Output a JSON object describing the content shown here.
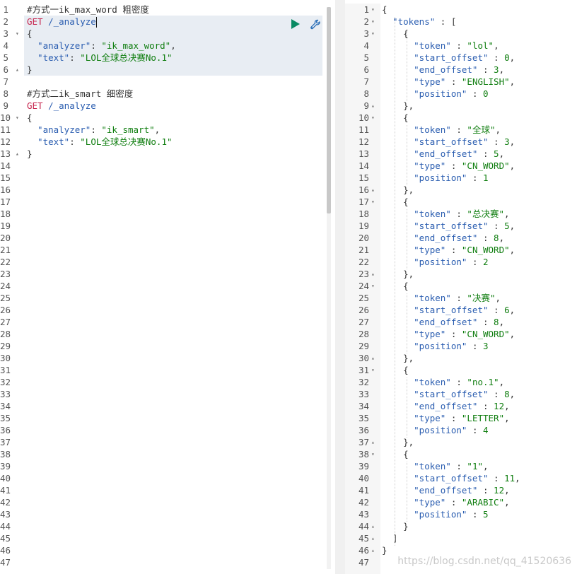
{
  "left_editor": {
    "lines": [
      [
        {
          "t": "#方式一ik_max_word 粗密度",
          "c": "comment"
        }
      ],
      [
        {
          "t": "GET",
          "c": "method"
        },
        {
          "t": " /_analyze",
          "c": "path"
        }
      ],
      [
        {
          "t": "{",
          "c": "punc"
        }
      ],
      [
        {
          "t": "  \"analyzer\"",
          "c": "key"
        },
        {
          "t": ": ",
          "c": "punc"
        },
        {
          "t": "\"ik_max_word\"",
          "c": "str"
        },
        {
          "t": ",",
          "c": "punc"
        }
      ],
      [
        {
          "t": "  \"text\"",
          "c": "key"
        },
        {
          "t": ": ",
          "c": "punc"
        },
        {
          "t": "\"LOL全球总决赛No.1\"",
          "c": "str"
        }
      ],
      [
        {
          "t": "}",
          "c": "punc"
        }
      ],
      [],
      [
        {
          "t": "#方式二ik_smart 细密度",
          "c": "comment"
        }
      ],
      [
        {
          "t": "GET",
          "c": "method"
        },
        {
          "t": " /_analyze",
          "c": "path"
        }
      ],
      [
        {
          "t": "{",
          "c": "punc"
        }
      ],
      [
        {
          "t": "  \"analyzer\"",
          "c": "key"
        },
        {
          "t": ": ",
          "c": "punc"
        },
        {
          "t": "\"ik_smart\"",
          "c": "str"
        },
        {
          "t": ",",
          "c": "punc"
        }
      ],
      [
        {
          "t": "  \"text\"",
          "c": "key"
        },
        {
          "t": ": ",
          "c": "punc"
        },
        {
          "t": "\"LOL全球总决赛No.1\"",
          "c": "str"
        }
      ],
      [
        {
          "t": "}",
          "c": "punc"
        }
      ]
    ],
    "total_line_numbers": 47,
    "folds": {
      "3": "open",
      "6": "close",
      "10": "open",
      "13": "close"
    }
  },
  "right_output": {
    "lines": [
      [
        {
          "t": "{",
          "c": "punc"
        }
      ],
      [
        {
          "t": "  \"tokens\"",
          "c": "key"
        },
        {
          "t": " : [",
          "c": "punc"
        }
      ],
      [
        {
          "t": "    {",
          "c": "punc"
        }
      ],
      [
        {
          "t": "      \"token\"",
          "c": "key"
        },
        {
          "t": " : ",
          "c": "punc"
        },
        {
          "t": "\"lol\"",
          "c": "str"
        },
        {
          "t": ",",
          "c": "punc"
        }
      ],
      [
        {
          "t": "      \"start_offset\"",
          "c": "key"
        },
        {
          "t": " : ",
          "c": "punc"
        },
        {
          "t": "0",
          "c": "num"
        },
        {
          "t": ",",
          "c": "punc"
        }
      ],
      [
        {
          "t": "      \"end_offset\"",
          "c": "key"
        },
        {
          "t": " : ",
          "c": "punc"
        },
        {
          "t": "3",
          "c": "num"
        },
        {
          "t": ",",
          "c": "punc"
        }
      ],
      [
        {
          "t": "      \"type\"",
          "c": "key"
        },
        {
          "t": " : ",
          "c": "punc"
        },
        {
          "t": "\"ENGLISH\"",
          "c": "str"
        },
        {
          "t": ",",
          "c": "punc"
        }
      ],
      [
        {
          "t": "      \"position\"",
          "c": "key"
        },
        {
          "t": " : ",
          "c": "punc"
        },
        {
          "t": "0",
          "c": "num"
        }
      ],
      [
        {
          "t": "    },",
          "c": "punc"
        }
      ],
      [
        {
          "t": "    {",
          "c": "punc"
        }
      ],
      [
        {
          "t": "      \"token\"",
          "c": "key"
        },
        {
          "t": " : ",
          "c": "punc"
        },
        {
          "t": "\"全球\"",
          "c": "str"
        },
        {
          "t": ",",
          "c": "punc"
        }
      ],
      [
        {
          "t": "      \"start_offset\"",
          "c": "key"
        },
        {
          "t": " : ",
          "c": "punc"
        },
        {
          "t": "3",
          "c": "num"
        },
        {
          "t": ",",
          "c": "punc"
        }
      ],
      [
        {
          "t": "      \"end_offset\"",
          "c": "key"
        },
        {
          "t": " : ",
          "c": "punc"
        },
        {
          "t": "5",
          "c": "num"
        },
        {
          "t": ",",
          "c": "punc"
        }
      ],
      [
        {
          "t": "      \"type\"",
          "c": "key"
        },
        {
          "t": " : ",
          "c": "punc"
        },
        {
          "t": "\"CN_WORD\"",
          "c": "str"
        },
        {
          "t": ",",
          "c": "punc"
        }
      ],
      [
        {
          "t": "      \"position\"",
          "c": "key"
        },
        {
          "t": " : ",
          "c": "punc"
        },
        {
          "t": "1",
          "c": "num"
        }
      ],
      [
        {
          "t": "    },",
          "c": "punc"
        }
      ],
      [
        {
          "t": "    {",
          "c": "punc"
        }
      ],
      [
        {
          "t": "      \"token\"",
          "c": "key"
        },
        {
          "t": " : ",
          "c": "punc"
        },
        {
          "t": "\"总决赛\"",
          "c": "str"
        },
        {
          "t": ",",
          "c": "punc"
        }
      ],
      [
        {
          "t": "      \"start_offset\"",
          "c": "key"
        },
        {
          "t": " : ",
          "c": "punc"
        },
        {
          "t": "5",
          "c": "num"
        },
        {
          "t": ",",
          "c": "punc"
        }
      ],
      [
        {
          "t": "      \"end_offset\"",
          "c": "key"
        },
        {
          "t": " : ",
          "c": "punc"
        },
        {
          "t": "8",
          "c": "num"
        },
        {
          "t": ",",
          "c": "punc"
        }
      ],
      [
        {
          "t": "      \"type\"",
          "c": "key"
        },
        {
          "t": " : ",
          "c": "punc"
        },
        {
          "t": "\"CN_WORD\"",
          "c": "str"
        },
        {
          "t": ",",
          "c": "punc"
        }
      ],
      [
        {
          "t": "      \"position\"",
          "c": "key"
        },
        {
          "t": " : ",
          "c": "punc"
        },
        {
          "t": "2",
          "c": "num"
        }
      ],
      [
        {
          "t": "    },",
          "c": "punc"
        }
      ],
      [
        {
          "t": "    {",
          "c": "punc"
        }
      ],
      [
        {
          "t": "      \"token\"",
          "c": "key"
        },
        {
          "t": " : ",
          "c": "punc"
        },
        {
          "t": "\"决赛\"",
          "c": "str"
        },
        {
          "t": ",",
          "c": "punc"
        }
      ],
      [
        {
          "t": "      \"start_offset\"",
          "c": "key"
        },
        {
          "t": " : ",
          "c": "punc"
        },
        {
          "t": "6",
          "c": "num"
        },
        {
          "t": ",",
          "c": "punc"
        }
      ],
      [
        {
          "t": "      \"end_offset\"",
          "c": "key"
        },
        {
          "t": " : ",
          "c": "punc"
        },
        {
          "t": "8",
          "c": "num"
        },
        {
          "t": ",",
          "c": "punc"
        }
      ],
      [
        {
          "t": "      \"type\"",
          "c": "key"
        },
        {
          "t": " : ",
          "c": "punc"
        },
        {
          "t": "\"CN_WORD\"",
          "c": "str"
        },
        {
          "t": ",",
          "c": "punc"
        }
      ],
      [
        {
          "t": "      \"position\"",
          "c": "key"
        },
        {
          "t": " : ",
          "c": "punc"
        },
        {
          "t": "3",
          "c": "num"
        }
      ],
      [
        {
          "t": "    },",
          "c": "punc"
        }
      ],
      [
        {
          "t": "    {",
          "c": "punc"
        }
      ],
      [
        {
          "t": "      \"token\"",
          "c": "key"
        },
        {
          "t": " : ",
          "c": "punc"
        },
        {
          "t": "\"no.1\"",
          "c": "str"
        },
        {
          "t": ",",
          "c": "punc"
        }
      ],
      [
        {
          "t": "      \"start_offset\"",
          "c": "key"
        },
        {
          "t": " : ",
          "c": "punc"
        },
        {
          "t": "8",
          "c": "num"
        },
        {
          "t": ",",
          "c": "punc"
        }
      ],
      [
        {
          "t": "      \"end_offset\"",
          "c": "key"
        },
        {
          "t": " : ",
          "c": "punc"
        },
        {
          "t": "12",
          "c": "num"
        },
        {
          "t": ",",
          "c": "punc"
        }
      ],
      [
        {
          "t": "      \"type\"",
          "c": "key"
        },
        {
          "t": " : ",
          "c": "punc"
        },
        {
          "t": "\"LETTER\"",
          "c": "str"
        },
        {
          "t": ",",
          "c": "punc"
        }
      ],
      [
        {
          "t": "      \"position\"",
          "c": "key"
        },
        {
          "t": " : ",
          "c": "punc"
        },
        {
          "t": "4",
          "c": "num"
        }
      ],
      [
        {
          "t": "    },",
          "c": "punc"
        }
      ],
      [
        {
          "t": "    {",
          "c": "punc"
        }
      ],
      [
        {
          "t": "      \"token\"",
          "c": "key"
        },
        {
          "t": " : ",
          "c": "punc"
        },
        {
          "t": "\"1\"",
          "c": "str"
        },
        {
          "t": ",",
          "c": "punc"
        }
      ],
      [
        {
          "t": "      \"start_offset\"",
          "c": "key"
        },
        {
          "t": " : ",
          "c": "punc"
        },
        {
          "t": "11",
          "c": "num"
        },
        {
          "t": ",",
          "c": "punc"
        }
      ],
      [
        {
          "t": "      \"end_offset\"",
          "c": "key"
        },
        {
          "t": " : ",
          "c": "punc"
        },
        {
          "t": "12",
          "c": "num"
        },
        {
          "t": ",",
          "c": "punc"
        }
      ],
      [
        {
          "t": "      \"type\"",
          "c": "key"
        },
        {
          "t": " : ",
          "c": "punc"
        },
        {
          "t": "\"ARABIC\"",
          "c": "str"
        },
        {
          "t": ",",
          "c": "punc"
        }
      ],
      [
        {
          "t": "      \"position\"",
          "c": "key"
        },
        {
          "t": " : ",
          "c": "punc"
        },
        {
          "t": "5",
          "c": "num"
        }
      ],
      [
        {
          "t": "    }",
          "c": "punc"
        }
      ],
      [
        {
          "t": "  ]",
          "c": "punc"
        }
      ],
      [
        {
          "t": "}",
          "c": "punc"
        }
      ]
    ],
    "total_line_numbers": 47,
    "folds": {
      "1": "open",
      "2": "open",
      "3": "open",
      "9": "close",
      "10": "open",
      "16": "close",
      "17": "open",
      "23": "close",
      "24": "open",
      "30": "close",
      "31": "open",
      "37": "close",
      "38": "open",
      "44": "close",
      "45": "close",
      "46": "close"
    }
  },
  "watermark": "https://blog.csdn.net/qq_41520636",
  "colors": {
    "method": "#c7254e",
    "key": "#2a5db0",
    "string": "#0e7d0e",
    "active_block": "#e8edf3",
    "run_button": "#0a8a63"
  },
  "icons": [
    "run-request-icon",
    "wrench-icon"
  ]
}
